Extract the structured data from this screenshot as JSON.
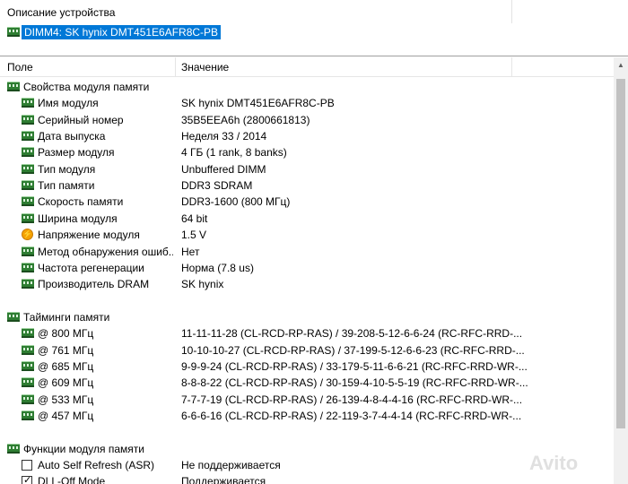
{
  "description": {
    "title": "Описание устройства",
    "selected": "DIMM4: SK hynix DMT451E6AFR8C-PB"
  },
  "columns": {
    "field": "Поле",
    "value": "Значение"
  },
  "sections": [
    {
      "title": "Свойства модуля памяти"
    },
    {
      "title": "Тайминги памяти"
    },
    {
      "title": "Функции модуля памяти"
    }
  ],
  "properties": [
    {
      "name": "Имя модуля",
      "value": "SK hynix DMT451E6AFR8C-PB",
      "icon": "memory-icon"
    },
    {
      "name": "Серийный номер",
      "value": "35B5EEA6h (2800661813)",
      "icon": "memory-icon"
    },
    {
      "name": "Дата выпуска",
      "value": "Неделя 33 / 2014",
      "icon": "memory-icon"
    },
    {
      "name": "Размер модуля",
      "value": "4 ГБ (1 rank, 8 banks)",
      "icon": "memory-icon"
    },
    {
      "name": "Тип модуля",
      "value": "Unbuffered DIMM",
      "icon": "memory-icon"
    },
    {
      "name": "Тип памяти",
      "value": "DDR3 SDRAM",
      "icon": "memory-icon"
    },
    {
      "name": "Скорость памяти",
      "value": "DDR3-1600 (800 МГц)",
      "icon": "memory-icon"
    },
    {
      "name": "Ширина модуля",
      "value": "64 bit",
      "icon": "memory-icon"
    },
    {
      "name": "Напряжение модуля",
      "value": "1.5 V",
      "icon": "voltage-icon"
    },
    {
      "name": "Метод обнаружения ошиб...",
      "value": "Нет",
      "icon": "memory-icon"
    },
    {
      "name": "Частота регенерации",
      "value": "Норма (7.8 us)",
      "icon": "memory-icon"
    },
    {
      "name": "Производитель DRAM",
      "value": "SK hynix",
      "icon": "memory-icon"
    }
  ],
  "timings": [
    {
      "name": "@ 800 МГц",
      "value": "11-11-11-28  (CL-RCD-RP-RAS) / 39-208-5-12-6-6-24  (RC-RFC-RRD-..."
    },
    {
      "name": "@ 761 МГц",
      "value": "10-10-10-27  (CL-RCD-RP-RAS) / 37-199-5-12-6-6-23  (RC-RFC-RRD-..."
    },
    {
      "name": "@ 685 МГц",
      "value": "9-9-9-24  (CL-RCD-RP-RAS) / 33-179-5-11-6-6-21  (RC-RFC-RRD-WR-..."
    },
    {
      "name": "@ 609 МГц",
      "value": "8-8-8-22  (CL-RCD-RP-RAS) / 30-159-4-10-5-5-19  (RC-RFC-RRD-WR-..."
    },
    {
      "name": "@ 533 МГц",
      "value": "7-7-7-19  (CL-RCD-RP-RAS) / 26-139-4-8-4-4-16  (RC-RFC-RRD-WR-..."
    },
    {
      "name": "@ 457 МГц",
      "value": "6-6-6-16  (CL-RCD-RP-RAS) / 22-119-3-7-4-4-14  (RC-RFC-RRD-WR-..."
    }
  ],
  "features": [
    {
      "name": "Auto Self Refresh (ASR)",
      "value": "Не поддерживается",
      "checked": false
    },
    {
      "name": "DLL-Off Mode",
      "value": "Поддерживается",
      "checked": true
    }
  ],
  "watermark": "Avito"
}
